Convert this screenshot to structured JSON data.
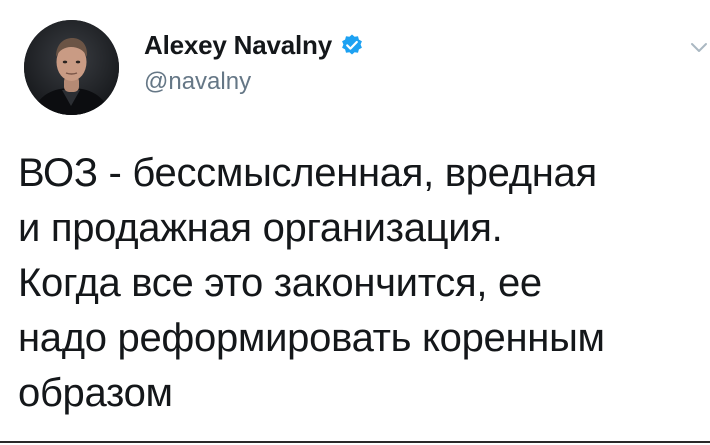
{
  "tweet": {
    "author": {
      "display_name": "Alexey Navalny",
      "handle": "@navalny",
      "verified": true,
      "avatar": "profile-photo"
    },
    "text_lines": [
      "ВОЗ - бессмысленная, вредная",
      "и продажная организация.",
      "Когда все это закончится, ее",
      "надо реформировать коренным",
      "образом"
    ],
    "icons": {
      "verified": "verified-badge-icon",
      "menu": "chevron-down-icon"
    },
    "colors": {
      "verified_blue": "#1da1f2",
      "handle_gray": "#657786",
      "text": "#14171a",
      "caret_gray": "#aab8c2"
    }
  }
}
